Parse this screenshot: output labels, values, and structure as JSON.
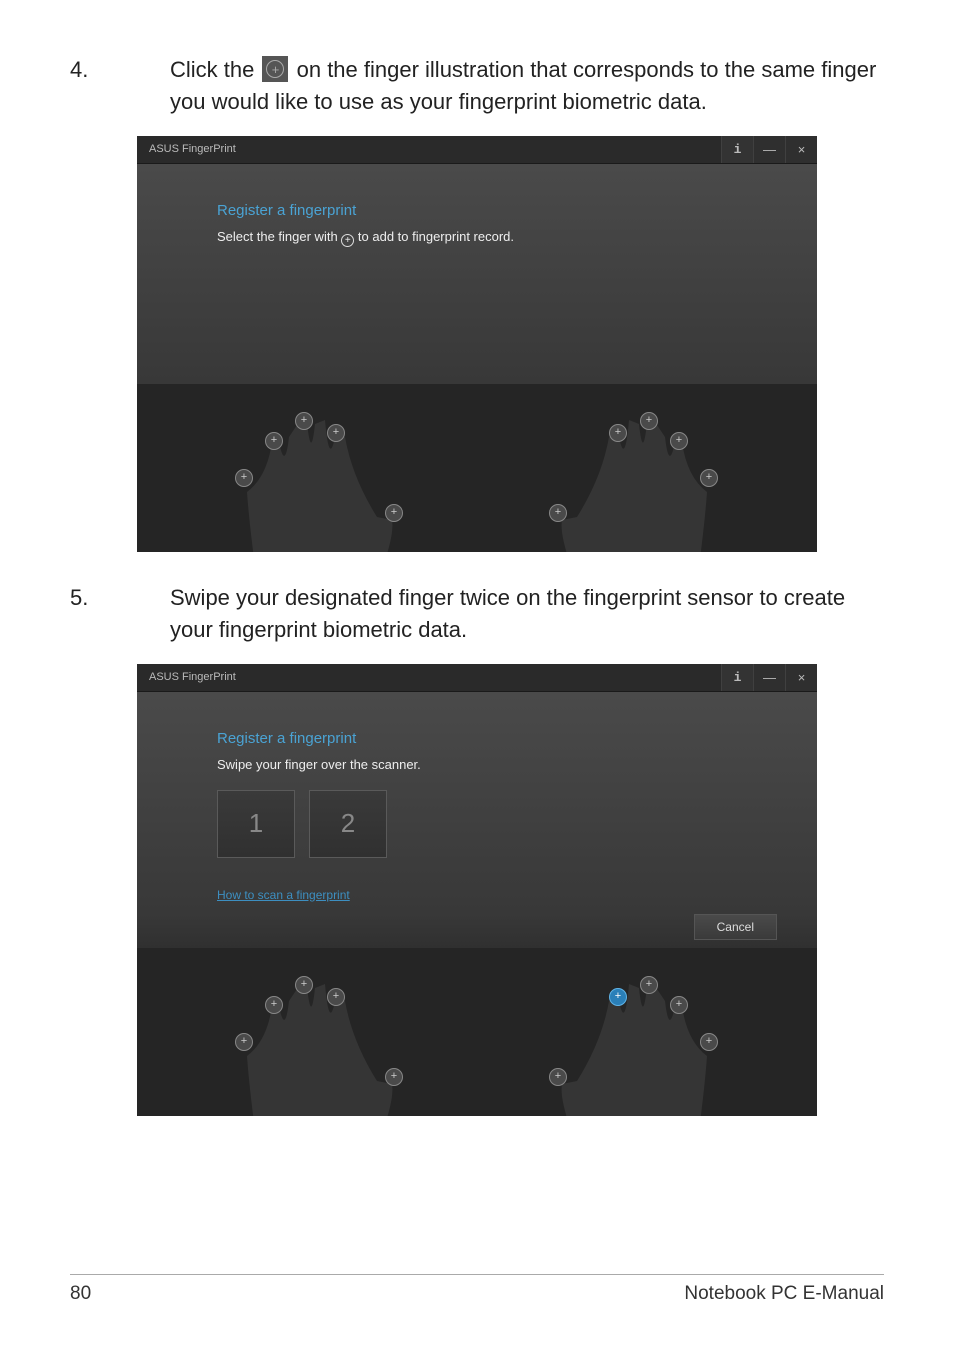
{
  "steps": {
    "s4": {
      "num": "4.",
      "text_before": "Click the ",
      "text_after": " on the finger illustration that corresponds to the same finger you would like to use as your fingerprint biometric data."
    },
    "s5": {
      "num": "5.",
      "text": "Swipe your designated finger twice on the fingerprint sensor to create your fingerprint biometric data."
    }
  },
  "app": {
    "title": "ASUS FingerPrint",
    "info_glyph": "i",
    "min_glyph": "—",
    "close_glyph": "×"
  },
  "screen1": {
    "heading": "Register a fingerprint",
    "sub_before": "Select the finger with ",
    "sub_after": " to add to fingerprint record."
  },
  "screen2": {
    "heading": "Register a fingerprint",
    "sub": "Swipe your finger over the scanner.",
    "box1": "1",
    "box2": "2",
    "howto": "How to scan a fingerprint",
    "cancel": "Cancel"
  },
  "footer": {
    "page": "80",
    "title": "Notebook PC E-Manual"
  }
}
